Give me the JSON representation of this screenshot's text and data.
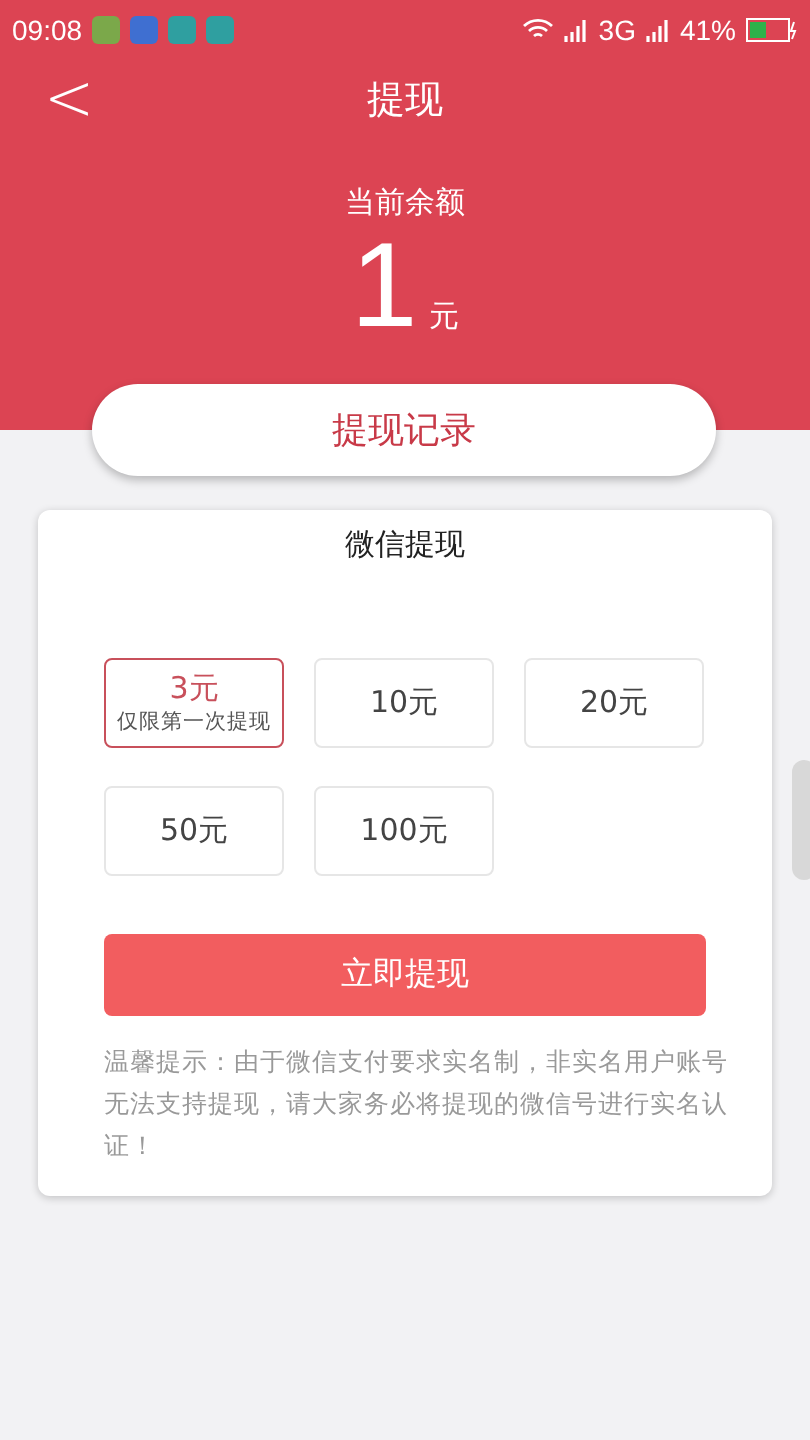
{
  "status_bar": {
    "time": "09:08",
    "network": "3G",
    "battery": "41%"
  },
  "header": {
    "back": "<",
    "title": "提现",
    "balance_label": "当前余额",
    "balance": "1",
    "unit": "元"
  },
  "record_button": "提现记录",
  "card": {
    "title": "微信提现",
    "options": [
      {
        "amount": "3元",
        "note": "仅限第一次提现",
        "selected": true
      },
      {
        "amount": "10元",
        "selected": false
      },
      {
        "amount": "20元",
        "selected": false
      },
      {
        "amount": "50元",
        "selected": false
      },
      {
        "amount": "100元",
        "selected": false
      }
    ],
    "submit": "立即提现",
    "tip": "温馨提示：由于微信支付要求实名制，非实名用户账号无法支持提现，请大家务必将提现的微信号进行实名认证！"
  }
}
